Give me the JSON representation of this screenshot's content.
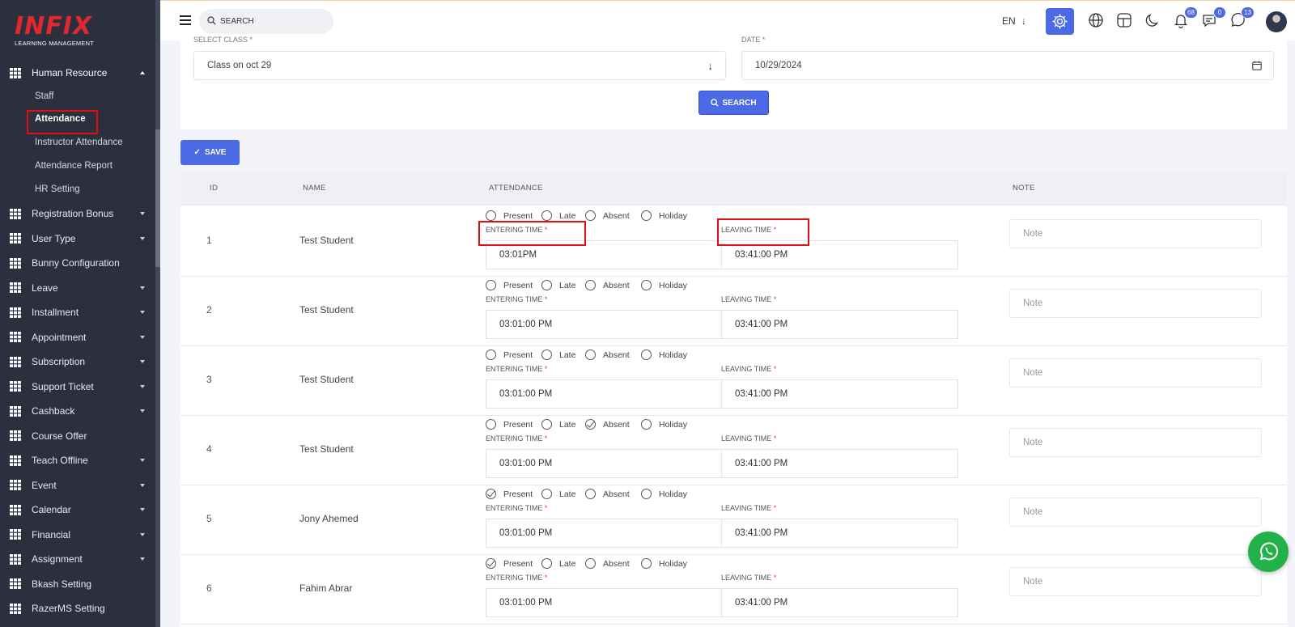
{
  "app": {
    "logo_main": "INFIX",
    "logo_sub": "LEARNING MANAGEMENT"
  },
  "header": {
    "search_placeholder": "SEARCH",
    "language": "EN",
    "notifications_count": "68",
    "messages_count": "0",
    "whatsapp_count": "13",
    "accent_color": "#4d6ae6"
  },
  "sidebar": {
    "active_group": {
      "label": "Human Resource",
      "icon": "grid-icon",
      "children": [
        {
          "label": "Staff"
        },
        {
          "label": "Attendance",
          "active": true
        },
        {
          "label": "Instructor Attendance"
        },
        {
          "label": "Attendance Report"
        },
        {
          "label": "HR Setting"
        }
      ]
    },
    "items": [
      {
        "label": "Registration Bonus",
        "has_children": true
      },
      {
        "label": "User Type",
        "has_children": true
      },
      {
        "label": "Bunny Configuration",
        "has_children": false
      },
      {
        "label": "Leave",
        "has_children": true
      },
      {
        "label": "Installment",
        "has_children": true
      },
      {
        "label": "Appointment",
        "has_children": true
      },
      {
        "label": "Subscription",
        "has_children": true
      },
      {
        "label": "Support Ticket",
        "has_children": true
      },
      {
        "label": "Cashback",
        "has_children": true
      },
      {
        "label": "Course Offer",
        "has_children": false
      },
      {
        "label": "Teach Offline",
        "has_children": true
      },
      {
        "label": "Event",
        "has_children": true
      },
      {
        "label": "Calendar",
        "has_children": true
      },
      {
        "label": "Financial",
        "has_children": true
      },
      {
        "label": "Assignment",
        "has_children": true
      },
      {
        "label": "Bkash Setting",
        "has_children": false
      },
      {
        "label": "RazerMS Setting",
        "has_children": false
      }
    ]
  },
  "filter": {
    "class_label": "SELECT CLASS *",
    "class_value": "Class on oct 29",
    "date_label": "DATE *",
    "date_value": "10/29/2024",
    "search_button": "SEARCH"
  },
  "actions": {
    "save_button": "SAVE"
  },
  "table": {
    "headers": {
      "id": "ID",
      "name": "NAME",
      "attendance": "ATTENDANCE",
      "note": "NOTE"
    },
    "attendance_options": [
      "Present",
      "Late",
      "Absent",
      "Holiday"
    ],
    "entering_label": "ENTERING TIME",
    "leaving_label": "LEAVING TIME",
    "required_mark": "*",
    "note_placeholder": "Note",
    "rows": [
      {
        "id": "1",
        "name": "Test Student",
        "status": "",
        "entering": "03:01PM",
        "leaving": "03:41:00 PM"
      },
      {
        "id": "2",
        "name": "Test Student",
        "status": "",
        "entering": "03:01:00 PM",
        "leaving": "03:41:00 PM"
      },
      {
        "id": "3",
        "name": "Test Student",
        "status": "",
        "entering": "03:01:00 PM",
        "leaving": "03:41:00 PM"
      },
      {
        "id": "4",
        "name": "Test Student",
        "status": "Absent",
        "entering": "03:01:00 PM",
        "leaving": "03:41:00 PM"
      },
      {
        "id": "5",
        "name": "Jony Ahemed",
        "status": "Present",
        "entering": "03:01:00 PM",
        "leaving": "03:41:00 PM"
      },
      {
        "id": "6",
        "name": "Fahim Abrar",
        "status": "Present",
        "entering": "03:01:00 PM",
        "leaving": "03:41:00 PM"
      }
    ]
  }
}
